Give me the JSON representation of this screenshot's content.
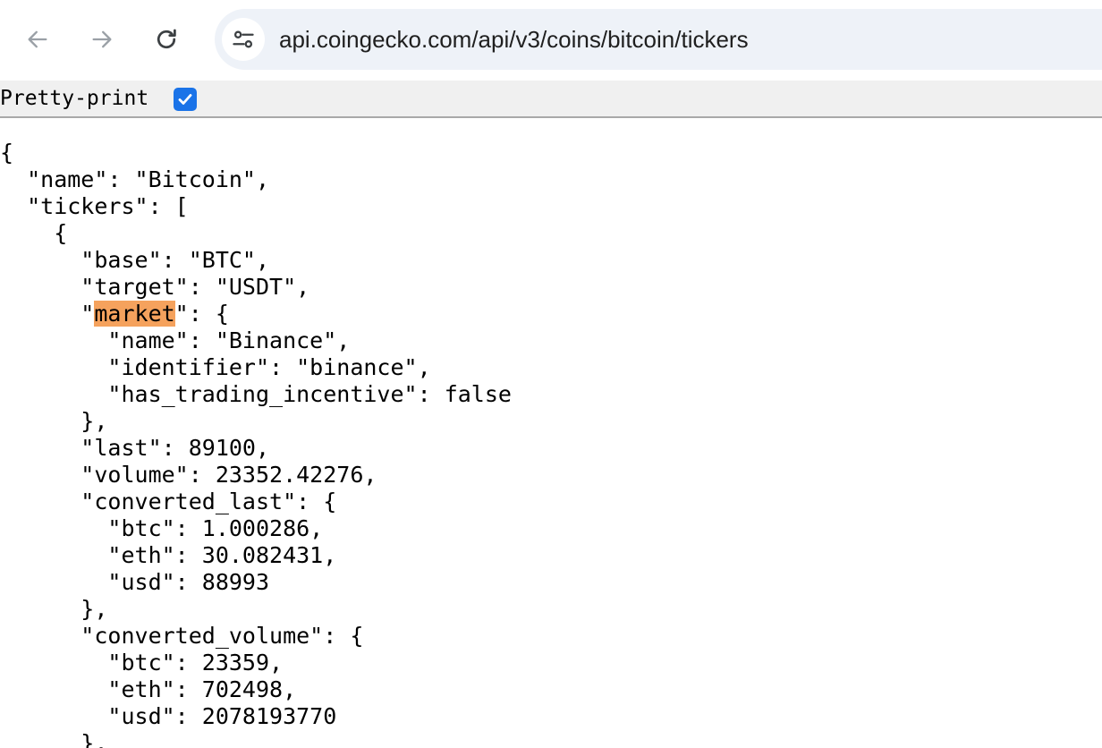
{
  "browser": {
    "url": "api.coingecko.com/api/v3/coins/bitcoin/tickers",
    "icons": {
      "back": "arrow-left-icon",
      "forward": "arrow-right-icon",
      "reload": "reload-icon",
      "site_info": "tune-icon"
    }
  },
  "viewer": {
    "pretty_print_label": "Pretty-print",
    "pretty_print_checked": true,
    "highlight_color": "#f5a25d",
    "checkbox_color": "#1a73e8"
  },
  "json_lines": [
    "{",
    "  \"name\": \"Bitcoin\",",
    "  \"tickers\": [",
    "    {",
    "      \"base\": \"BTC\",",
    "      \"target\": \"USDT\",",
    "      \"market\": {",
    "        \"name\": \"Binance\",",
    "        \"identifier\": \"binance\",",
    "        \"has_trading_incentive\": false",
    "      },",
    "      \"last\": 89100,",
    "      \"volume\": 23352.42276,",
    "      \"converted_last\": {",
    "        \"btc\": 1.000286,",
    "        \"eth\": 30.082431,",
    "        \"usd\": 88993",
    "      },",
    "      \"converted_volume\": {",
    "        \"btc\": 23359,",
    "        \"eth\": 702498,",
    "        \"usd\": 2078193770",
    "      },"
  ],
  "search_highlight": {
    "term": "market",
    "prefix": "      \"",
    "suffix": "\": {"
  }
}
